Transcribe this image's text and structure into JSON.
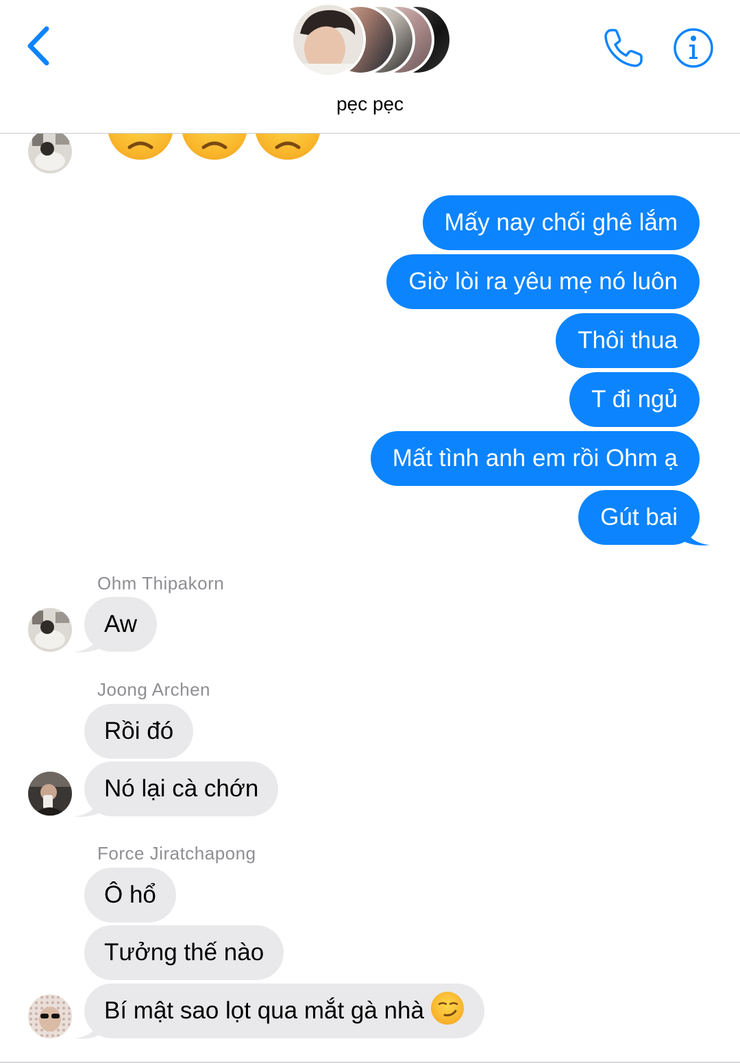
{
  "header": {
    "title": "pẹc pẹc",
    "accent_color": "#0b84fe",
    "icons": {
      "back": "chevron-left-icon",
      "call": "phone-icon",
      "info": "info-icon"
    }
  },
  "messages": {
    "outgoing": [
      "Mấy nay chối ghê lắm",
      "Giờ lòi ra yêu mẹ nó luôn",
      "Thôi thua",
      "T đi ngủ",
      "Mất tình anh em rồi Ohm ạ",
      "Gút bai"
    ],
    "groups": [
      {
        "sender": "Ohm Thipakorn",
        "messages": [
          "Aw"
        ]
      },
      {
        "sender": "Joong Archen",
        "messages": [
          "Rồi đó",
          "Nó lại cà chớn"
        ]
      },
      {
        "sender": "Force Jiratchapong",
        "messages": [
          "Ô hổ",
          "Tưởng thế nào",
          "Bí mật sao lọt qua mắt gà nhà"
        ]
      }
    ]
  },
  "colors": {
    "outgoing_bubble": "#0b84fe",
    "incoming_bubble": "#e9e9eb",
    "sender_name": "#8e8e93"
  }
}
